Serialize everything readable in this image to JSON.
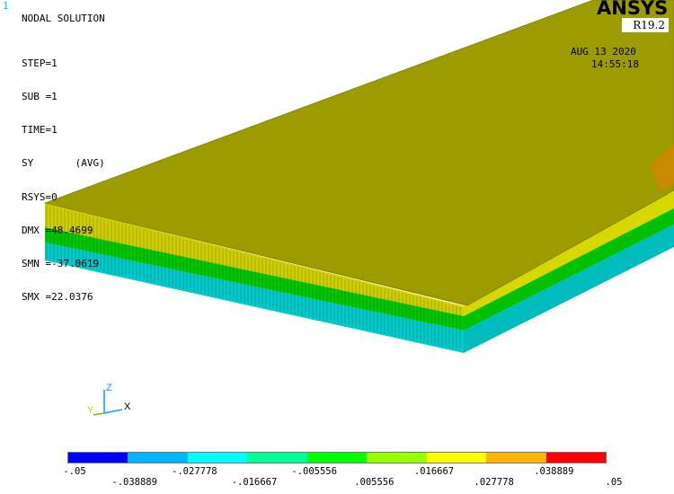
{
  "window": {
    "number": "1"
  },
  "header": {
    "title": "NODAL SOLUTION"
  },
  "info_lines": [
    "STEP=1",
    "SUB =1",
    "TIME=1",
    "SY       (AVG)",
    "RSYS=0",
    "DMX =48.4699",
    "SMN =-37.0619",
    "SMX =22.0376"
  ],
  "logo": {
    "name": "ANSYS",
    "version": "R19.2"
  },
  "timestamp": {
    "date": "AUG 13 2020",
    "time": "14:55:18"
  },
  "triad": {
    "x_label": "X",
    "y_label": "Y",
    "z_label": "Z"
  },
  "legend": {
    "colors": [
      "#0000ff",
      "#00b4ff",
      "#00ffff",
      "#00ff96",
      "#00ff00",
      "#96ff00",
      "#ffff00",
      "#ffb400",
      "#ff0000"
    ],
    "ticks_top": [
      "-.05",
      "-.027778",
      "-.005556",
      ".016667",
      ".038889"
    ],
    "ticks_bottom": [
      "-.038889",
      "-.016667",
      ".005556",
      ".027778",
      ".05"
    ]
  },
  "colors": {
    "model_face": "#9c9c00",
    "side_yellow": "#d8d800",
    "side_green": "#00c800",
    "side_cyan": "#00d0d0"
  }
}
